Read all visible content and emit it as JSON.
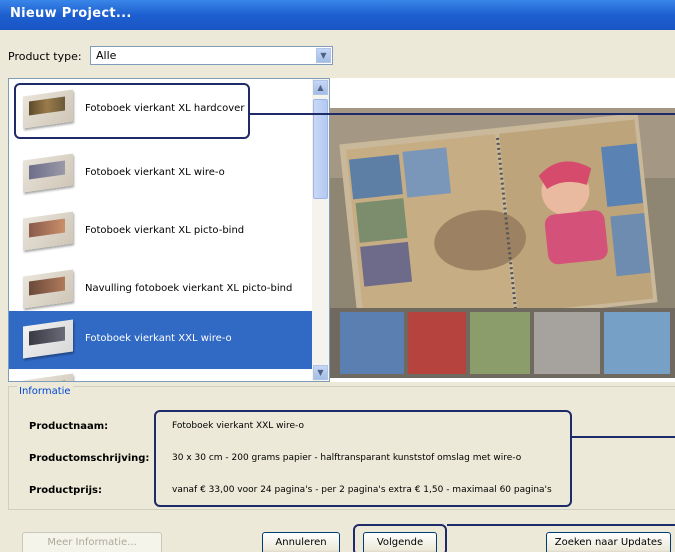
{
  "window": {
    "title": "Nieuw Project..."
  },
  "product_type": {
    "label": "Product type:",
    "value": "Alle"
  },
  "products": [
    {
      "label": "Fotoboek vierkant XL hardcover",
      "selected": false
    },
    {
      "label": "Fotoboek vierkant XL wire-o",
      "selected": false
    },
    {
      "label": "Fotoboek vierkant XL picto-bind",
      "selected": false
    },
    {
      "label": "Navulling fotoboek vierkant XL picto-bind",
      "selected": false
    },
    {
      "label": "Fotoboek vierkant XXL wire-o",
      "selected": true
    },
    {
      "label": "",
      "selected": false
    }
  ],
  "info": {
    "legend": "Informatie",
    "name_label": "Productnaam:",
    "name_value": "Fotoboek vierkant XXL wire-o",
    "desc_label": "Productomschrijving:",
    "desc_value": "30 x 30 cm - 200 grams papier - halftransparant kunststof omslag met wire-o",
    "price_label": "Productprijs:",
    "price_value": "vanaf € 33,00 voor 24 pagina's - per 2 pagina's extra € 1,50 - maximaal 60 pagina's"
  },
  "buttons": {
    "more_info": "Meer Informatie...",
    "cancel": "Annuleren",
    "next": "Volgende",
    "updates": "Zoeken naar Updates"
  },
  "colors": {
    "titlebar": "#1d5fd0",
    "selection": "#316ac5",
    "annotation": "#1f2a68"
  },
  "icons": {
    "dropdown": "chevron-down-icon",
    "scroll_up": "arrow-up-icon",
    "scroll_down": "arrow-down-icon"
  }
}
